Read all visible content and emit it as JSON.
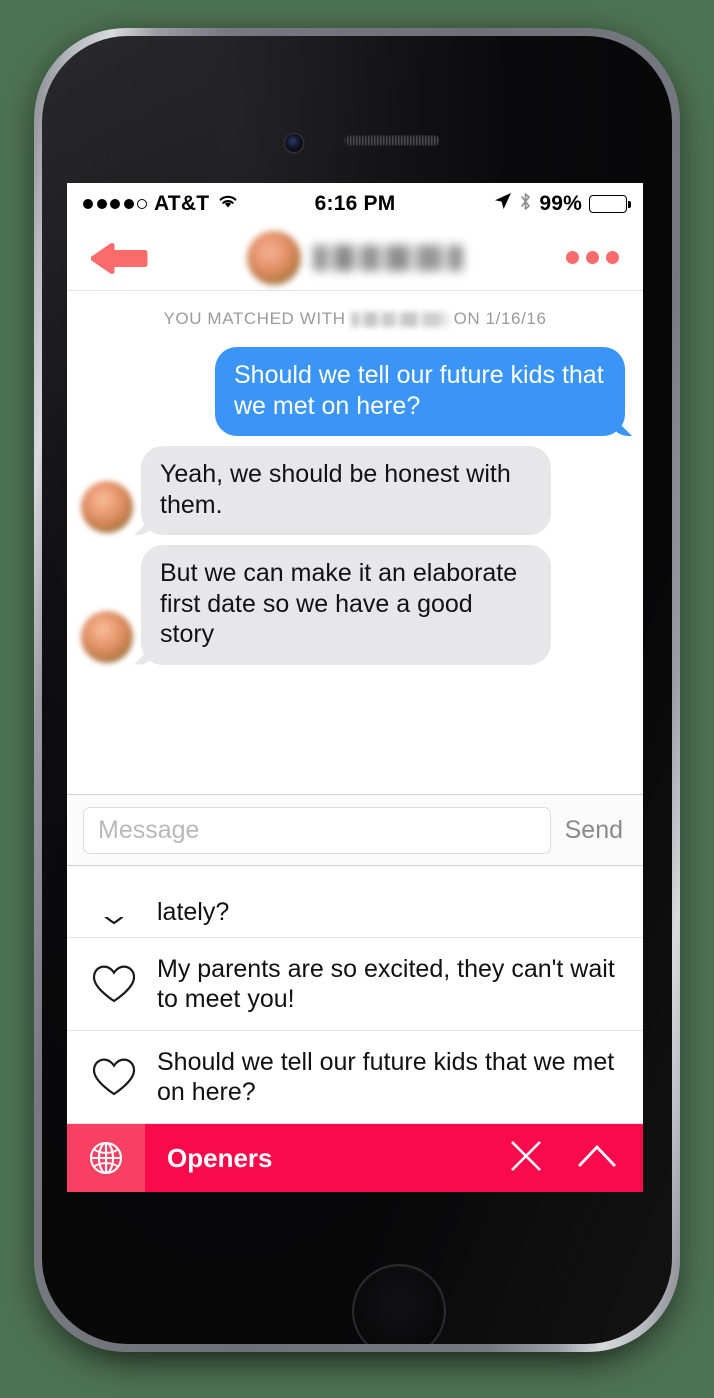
{
  "status_bar": {
    "signal_dots_filled": 4,
    "signal_dots_total": 5,
    "carrier": "AT&T",
    "wifi_icon": "wifi-icon",
    "time": "6:16 PM",
    "location_icon": "location-arrow-icon",
    "bluetooth_icon": "bluetooth-icon",
    "battery_percent": "99%",
    "battery_level": 99
  },
  "nav_bar": {
    "back_icon": "back-arrow-icon",
    "avatar": "match-avatar",
    "match_name_redacted": "",
    "more_icon": "more-options-icon"
  },
  "conversation": {
    "matched_prefix": "YOU MATCHED WITH",
    "matched_name_redacted": "",
    "matched_suffix": "ON 1/16/16",
    "matched_date": "1/16/16",
    "messages": [
      {
        "direction": "outgoing",
        "text": "Should we tell our future kids that we met on here?"
      },
      {
        "direction": "incoming",
        "text": "Yeah, we should be honest with them."
      },
      {
        "direction": "incoming",
        "text": "But we can make it an elaborate first date so we have a good story"
      }
    ]
  },
  "input_bar": {
    "placeholder": "Message",
    "value": "",
    "send_label": "Send"
  },
  "openers_panel": {
    "clipped_row_text": "lately?",
    "rows": [
      {
        "icon": "heart-icon",
        "text": "My parents are so excited, they can't wait to meet you!"
      },
      {
        "icon": "heart-icon",
        "text": "Should we tell our future kids that we met on here?"
      }
    ]
  },
  "openers_bar": {
    "globe_icon": "globe-icon",
    "title": "Openers",
    "close_icon": "close-icon",
    "expand_icon": "chevron-up-icon",
    "bar_color": "#F80A4B",
    "globe_cell_color": "#FA4062"
  },
  "colors": {
    "outgoing_bubble": "#3B95F7",
    "incoming_bubble": "#E7E7E9",
    "accent_coral": "#FC6B6B",
    "background": "#4E7352"
  }
}
